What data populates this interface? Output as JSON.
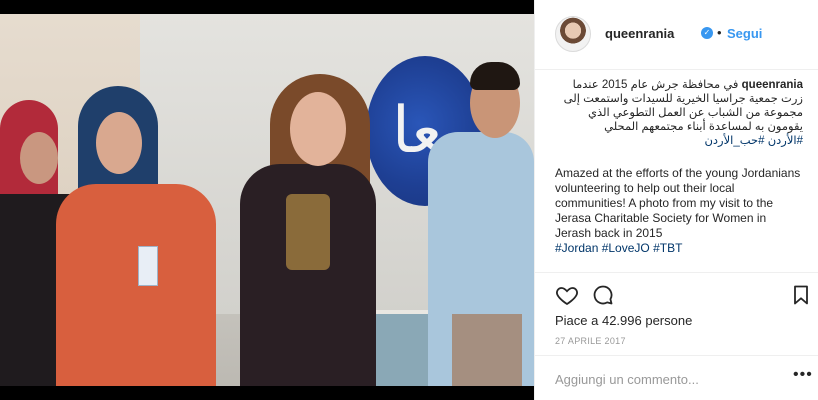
{
  "post": {
    "image_alt": "",
    "mural_glyph": "معا"
  },
  "header": {
    "username": "queenrania",
    "verified_icon": "verified-badge-icon",
    "separator": "•",
    "follow_label": "Segui"
  },
  "caption": {
    "username": "queenrania",
    "arabic_text": "في محافظة جرش عام 2015 عندما زرت جمعية جراسيا الخيرية للسيدات واستمعت إلى مجموعة من الشباب عن العمل التطوعي الذي يقومون به لمساعدة أبناء مجتمعهم المحلي",
    "arabic_tags": "#الأردن #حب_الأردن",
    "english_text": "Amazed at the efforts of the young Jordanians volunteering to help out their local communities! A photo from my visit to the Jerasa Charitable Society for Women in Jerash back in 2015",
    "english_tags": "#Jordan #LoveJO #TBT"
  },
  "actions": {
    "like_icon": "heart-icon",
    "comment_icon": "comment-icon",
    "save_icon": "bookmark-icon"
  },
  "likes_text": "Piace a 42.996 persone",
  "date_text": "27 APRILE 2017",
  "comment": {
    "placeholder": "Aggiungi un commento...",
    "more_label": "•••"
  },
  "colors": {
    "link_blue": "#3897f0",
    "hashtag": "#003569",
    "muted": "#999999"
  }
}
